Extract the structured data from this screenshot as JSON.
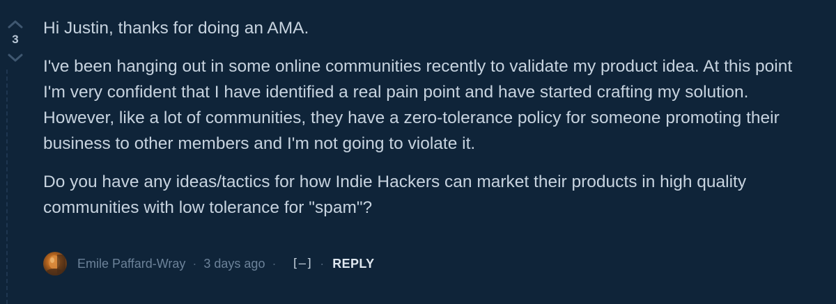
{
  "comment": {
    "vote_count": "3",
    "paragraphs": [
      "Hi Justin, thanks for doing an AMA.",
      "I've been hanging out in some online communities recently to validate my product idea. At this point I'm very confident that I have identified a real pain point and have started crafting my solution. However, like a lot of communities, they have a zero-tolerance policy for someone promoting their business to other members and I'm not going to violate it.",
      "Do you have any ideas/tactics for how Indie Hackers can market their products in high quality communities with low tolerance for \"spam\"?"
    ],
    "author": "Emile Paffard-Wray",
    "timestamp": "3 days ago",
    "collapse_label": "[–]",
    "reply_label": "REPLY",
    "separator": "·"
  },
  "icons": {
    "upvote": "chevron-up-icon",
    "downvote": "chevron-down-icon"
  },
  "colors": {
    "background": "#0f2439",
    "text": "#c7d3df",
    "meta": "#6c8299"
  }
}
